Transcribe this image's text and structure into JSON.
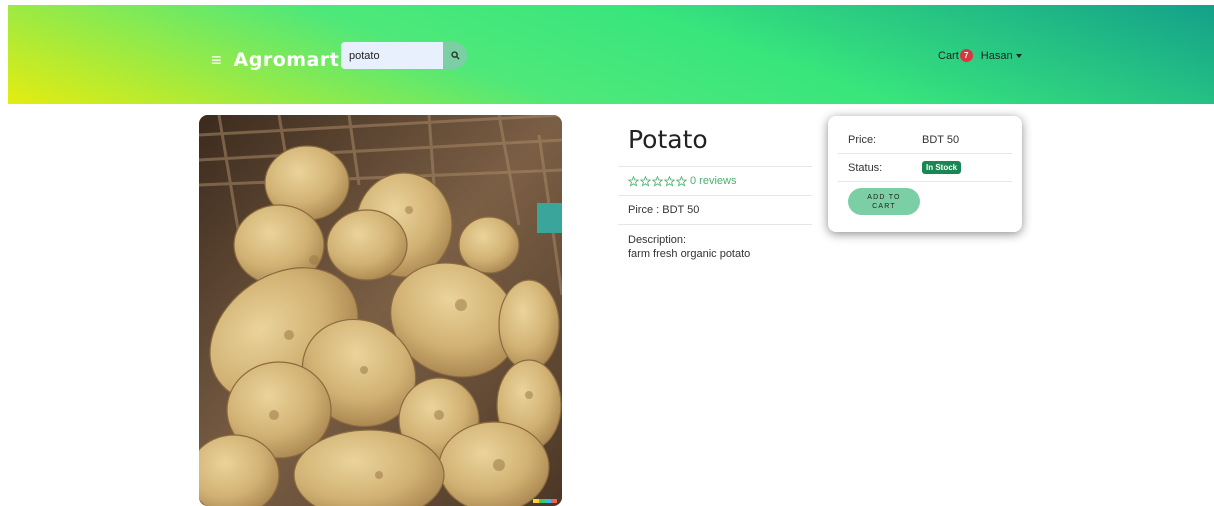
{
  "navbar": {
    "brand": "Agromart",
    "menu_icon": "hamburger-icon",
    "search": {
      "value": "potato",
      "icon": "search-icon"
    },
    "cart_label": "Cart",
    "cart_count": "7",
    "user_name": "Hasan",
    "colors": {
      "gradient_start": "#e4ec10",
      "gradient_mid": "#3fe87e",
      "gradient_end": "#14a08a"
    }
  },
  "product": {
    "name": "Potato",
    "reviews": "0 reviews",
    "rating_icons": "star-outline-icon",
    "price_line": "Pirce : BDT 50",
    "description_label": "Description:",
    "description": "farm fresh organic potato",
    "image": "potato-basket-photo"
  },
  "purchase_card": {
    "price_label": "Price:",
    "price_value": "BDT 50",
    "status_label": "Status:",
    "status_value": "In Stock",
    "button_line1": "ADD TO",
    "button_line2": "CART",
    "colors": {
      "stock_badge": "#198754",
      "button": "#7ccfa4"
    }
  }
}
